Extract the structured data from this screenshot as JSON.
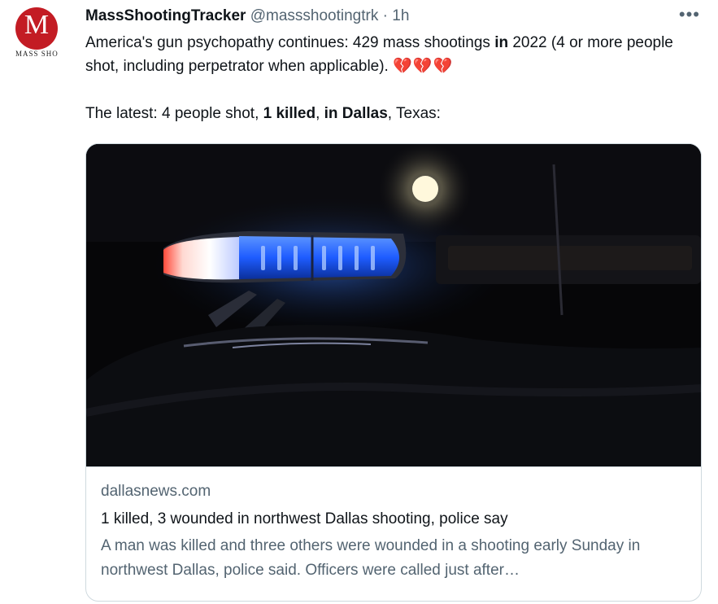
{
  "tweet": {
    "author": {
      "name": "MassShootingTracker",
      "handle": "@massshootingtrk",
      "separator": "·",
      "time": "1h",
      "avatar_letter": "M",
      "avatar_caption": "MASS SHOO"
    },
    "more_label": "•••",
    "text": {
      "line1_a": "America's gun psychopathy continues: 429 mass shootings ",
      "line1_bold": "in",
      "line1_b": " 2022 (4 or more people shot, including perpetrator when applicable). ",
      "hearts": "💔💔💔",
      "line2_a": "The latest: 4 people shot, ",
      "line2_bold1": "1 killed",
      "line2_sep": ", ",
      "line2_bold2": "in Dallas",
      "line2_b": ", Texas:"
    },
    "card": {
      "image_icon": "police-light-bar-image",
      "domain": "dallasnews.com",
      "title": "1 killed, 3 wounded in northwest Dallas shooting, police say",
      "description": "A man was killed and three others were wounded in a shooting early Sunday in northwest Dallas, police said. Officers were called just after…"
    }
  },
  "colors": {
    "text": "#0f1419",
    "secondary": "#536471",
    "border": "#cfd9de",
    "avatar_red": "#c31c24",
    "police_blue": "#2a6cff",
    "police_red": "#e0301e"
  }
}
